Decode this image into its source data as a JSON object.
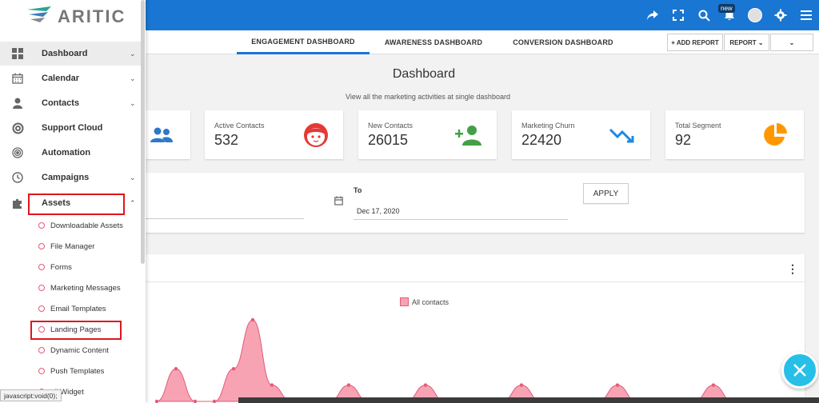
{
  "brand": {
    "logo_text": "ARITIC",
    "primary": "#1976d2",
    "accent": "#26bfe8",
    "alert": "#e0151c"
  },
  "topbar": {
    "icons": [
      "share-icon",
      "fullscreen-icon",
      "search-icon",
      "bell-icon",
      "avatar",
      "gear-icon",
      "menu-icon"
    ],
    "new_badge": "new"
  },
  "tabs": [
    {
      "label": "ENGAGEMENT DASHBOARD",
      "active": true
    },
    {
      "label": "AWARENESS DASHBOARD",
      "active": false
    },
    {
      "label": "CONVERSION DASHBOARD",
      "active": false
    }
  ],
  "toolbar": {
    "add_report": "+ ADD REPORT",
    "report": "REPORT ⌄",
    "more": "⌄"
  },
  "page": {
    "title": "Dashboard",
    "subtitle": "View all the marketing activities at single dashboard"
  },
  "cards": [
    {
      "label": "",
      "value": "",
      "icon": "users-icon"
    },
    {
      "label": "Active Contacts",
      "value": "532",
      "icon": "face-icon"
    },
    {
      "label": "New Contacts",
      "value": "26015",
      "icon": "add-user-icon"
    },
    {
      "label": "Marketing Churn",
      "value": "22420",
      "icon": "trend-down-icon"
    },
    {
      "label": "Total Segment",
      "value": "92",
      "icon": "pie-icon"
    }
  ],
  "filter": {
    "to_label": "To",
    "to_value": "Dec 17, 2020",
    "apply": "APPLY"
  },
  "chart_data": {
    "type": "area",
    "title": "",
    "xlabel": "",
    "ylabel": "",
    "series": [
      {
        "name": "All contacts",
        "values": [
          0,
          2,
          0,
          0,
          2,
          5,
          1,
          0,
          0,
          0,
          1,
          0,
          0,
          0,
          1,
          0,
          0,
          0,
          0,
          1,
          0,
          0,
          0,
          0,
          1,
          0,
          0,
          0,
          0,
          1,
          0,
          0,
          0,
          0
        ]
      }
    ],
    "color": "#f7a3b4",
    "stroke": "#e35b79"
  },
  "sidebar": {
    "items": [
      {
        "label": "Dashboard",
        "icon": "grid-icon",
        "chev": "⌄",
        "active": true
      },
      {
        "label": "Calendar",
        "icon": "calendar-icon",
        "chev": "⌄"
      },
      {
        "label": "Contacts",
        "icon": "person-icon",
        "chev": "⌄"
      },
      {
        "label": "Support Cloud",
        "icon": "lifebuoy-icon",
        "chev": ""
      },
      {
        "label": "Automation",
        "icon": "target-icon",
        "chev": ""
      },
      {
        "label": "Campaigns",
        "icon": "clock-icon",
        "chev": "⌄"
      },
      {
        "label": "Assets",
        "icon": "puzzle-icon",
        "chev": "⌃"
      }
    ],
    "sub_items": [
      "Downloadable Assets",
      "File Manager",
      "Forms",
      "Marketing Messages",
      "Email Templates",
      "Landing Pages",
      "Dynamic Content",
      "Push Templates",
      "ail Widget"
    ]
  },
  "status_bar": {
    "text": "javascript:void(0);"
  },
  "fab": {
    "icon": "close-icon"
  }
}
